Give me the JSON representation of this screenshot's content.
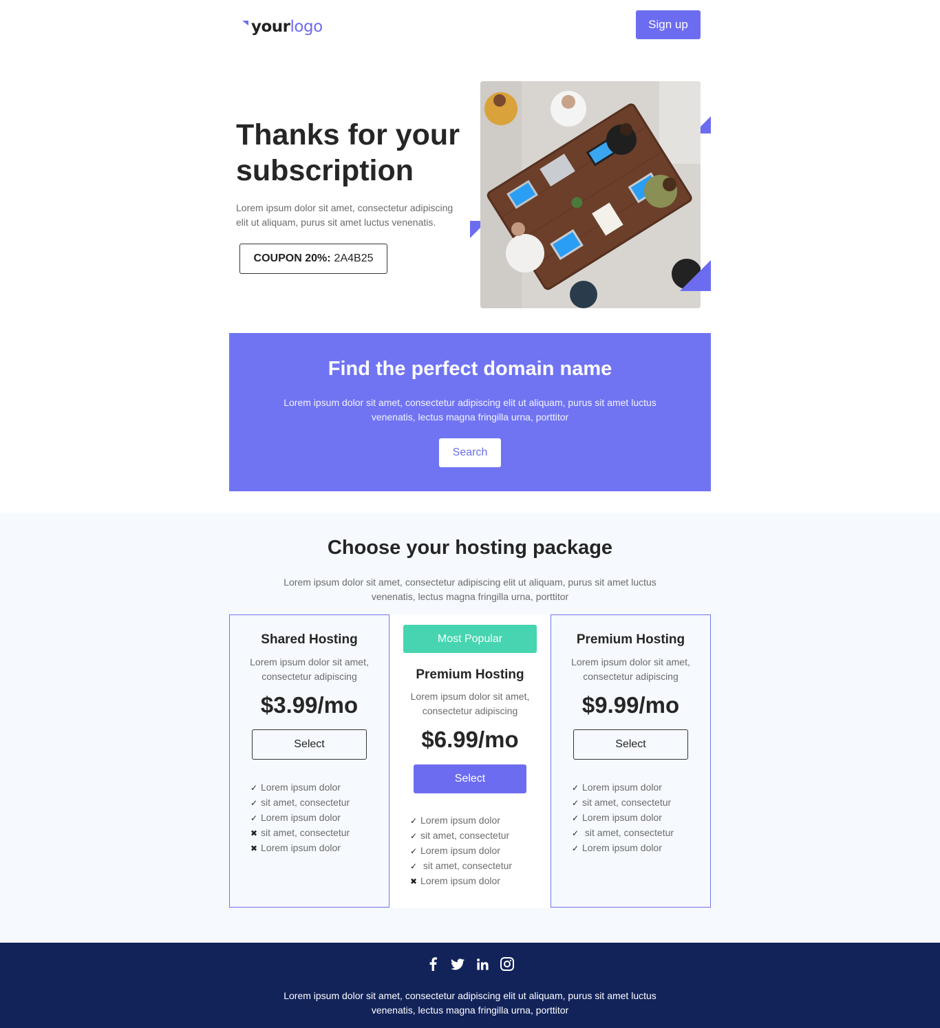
{
  "header": {
    "logo_part1": "your",
    "logo_part2": "logo",
    "signup_label": "Sign up"
  },
  "hero": {
    "title": "Thanks for your subscription",
    "text": "Lorem ipsum dolor sit amet, consectetur adipiscing elit ut aliquam, purus sit amet luctus venenatis.",
    "coupon_label": "COUPON 20%:",
    "coupon_code": "2A4B25",
    "image_subject": "team meeting around a wooden table seen from above"
  },
  "domain": {
    "title": "Find the perfect domain name",
    "text": "Lorem ipsum dolor sit amet, consectetur adipiscing elit ut aliquam, purus sit amet luctus venenatis, lectus magna fringilla urna, porttitor",
    "search_label": "Search"
  },
  "hosting": {
    "title": "Choose your hosting package",
    "text": "Lorem ipsum dolor sit amet, consectetur adipiscing elit ut aliquam, purus sit amet luctus venenatis, lectus magna fringilla urna, porttitor",
    "plans": [
      {
        "name": "Shared Hosting",
        "desc": "Lorem ipsum dolor sit amet, consectetur adipiscing",
        "price": "$3.99/mo",
        "button": "Select",
        "features": [
          {
            "mark": "✓",
            "text": "Lorem ipsum dolor"
          },
          {
            "mark": "✓",
            "text": "sit amet, consectetur"
          },
          {
            "mark": "✓",
            "text": "Lorem ipsum dolor"
          },
          {
            "mark": "✖",
            "text": "sit amet, consectetur"
          },
          {
            "mark": "✖",
            "text": "Lorem ipsum dolor"
          }
        ]
      },
      {
        "badge": "Most Popular",
        "name": "Premium Hosting",
        "desc": "Lorem ipsum dolor sit amet, consectetur adipiscing",
        "price": "$6.99/mo",
        "button": "Select",
        "features": [
          {
            "mark": "✓",
            "text": "Lorem ipsum dolor"
          },
          {
            "mark": "✓",
            "text": "sit amet, consectetur"
          },
          {
            "mark": "✓",
            "text": "Lorem ipsum dolor"
          },
          {
            "mark": "✓",
            "text": " sit amet, consectetur"
          },
          {
            "mark": "✖",
            "text": "Lorem ipsum dolor"
          }
        ]
      },
      {
        "name": "Premium Hosting",
        "desc": "Lorem ipsum dolor sit amet, consectetur adipiscing",
        "price": "$9.99/mo",
        "button": "Select",
        "features": [
          {
            "mark": "✓",
            "text": "Lorem ipsum dolor"
          },
          {
            "mark": "✓",
            "text": "sit amet, consectetur"
          },
          {
            "mark": "✓",
            "text": "Lorem ipsum dolor"
          },
          {
            "mark": "✓",
            "text": " sit amet, consectetur"
          },
          {
            "mark": "✓",
            "text": "Lorem ipsum dolor"
          }
        ]
      }
    ]
  },
  "footer": {
    "socials": [
      "facebook-icon",
      "twitter-icon",
      "linkedin-icon",
      "instagram-icon"
    ],
    "text": "Lorem ipsum dolor sit amet, consectetur adipiscing elit ut aliquam, purus sit amet luctus venenatis, lectus magna fringilla urna, porttitor"
  },
  "colors": {
    "accent": "#7074f2",
    "popular": "#46d5b0",
    "footer_bg": "#12235a",
    "section_bg": "#f6f9fd"
  }
}
